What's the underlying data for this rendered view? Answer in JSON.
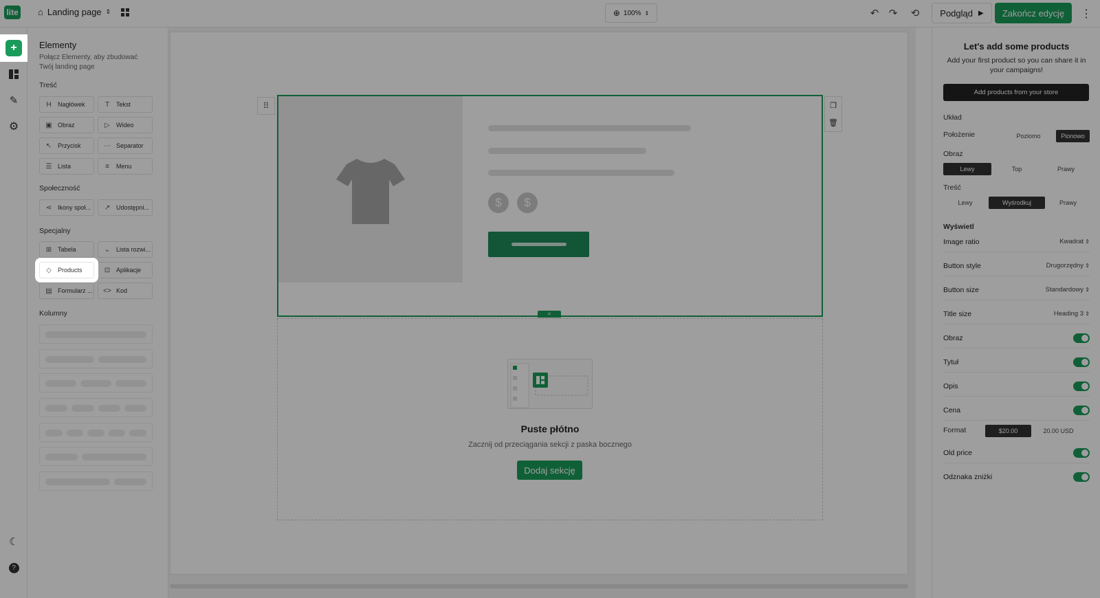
{
  "topbar": {
    "logo": "lite",
    "page_name": "Landing page",
    "zoom": "100%",
    "preview": "Podgląd",
    "finish": "Zakończ edycję"
  },
  "left_panel": {
    "title": "Elementy",
    "subtitle": "Połącz Elementy, aby zbudować Twój landing page",
    "sections": {
      "content": "Treść",
      "social": "Społeczność",
      "special": "Specjalny",
      "columns": "Kolumny"
    },
    "content_items": [
      "Nagłówek",
      "Tekst",
      "Obraz",
      "Wideo",
      "Przycisk",
      "Separator",
      "Lista",
      "Menu"
    ],
    "social_items": [
      "Ikony społ...",
      "Udostępni..."
    ],
    "special_items": [
      "Tabela",
      "Lista rozwi...",
      "Products",
      "Aplikacje",
      "Formularz ...",
      "Kod"
    ]
  },
  "canvas": {
    "empty_title": "Puste płótno",
    "empty_sub": "Zacznij od przeciągania sekcji z paska bocznego",
    "add_section": "Dodaj sekcję"
  },
  "right_panel": {
    "title": "Let's add some products",
    "subtitle": "Add your first product so you can share it in your campaigns!",
    "add_button": "Add products from your store",
    "layout_label": "Układ",
    "position_label": "Położenie",
    "position_options": [
      "Poziomo",
      "Pionowo"
    ],
    "image_label": "Obraz",
    "image_options": [
      "Lewy",
      "Top",
      "Prawy"
    ],
    "content_label": "Treść",
    "content_options": [
      "Lewy",
      "Wyśrodkuj",
      "Prawy"
    ],
    "display_label": "Wyświetl",
    "selects": [
      {
        "label": "Image ratio",
        "value": "Kwadrat"
      },
      {
        "label": "Button style",
        "value": "Drugorzędny"
      },
      {
        "label": "Button size",
        "value": "Standardowy"
      },
      {
        "label": "Title size",
        "value": "Heading 3"
      }
    ],
    "toggles": [
      "Obraz",
      "Tytuł",
      "Opis",
      "Cena"
    ],
    "format_label": "Format",
    "format_options": [
      "$20.00",
      "20.00 USD"
    ],
    "toggles2": [
      "Old price",
      "Odznaka zniżki"
    ]
  },
  "colors": {
    "accent": "#1a9b5a",
    "dark": "#222222"
  }
}
